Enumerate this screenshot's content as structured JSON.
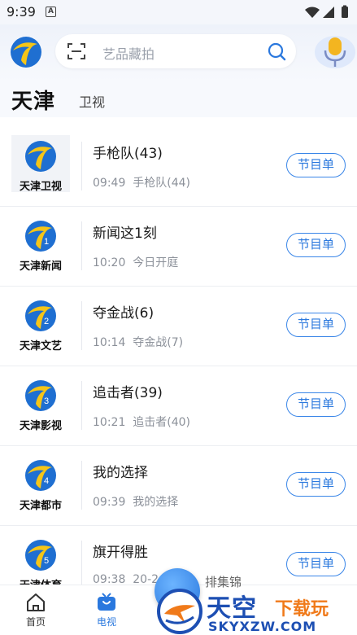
{
  "status_bar": {
    "time": "9:39",
    "notification_letter": "A"
  },
  "search": {
    "placeholder": "艺品藏拍"
  },
  "title_row": {
    "title": "天津",
    "tab": "卫视"
  },
  "channels": [
    {
      "name": "天津卫视",
      "badge": "",
      "now": "手枪队(43)",
      "next_time": "09:49",
      "next_title": "手枪队(44)",
      "button": "节目单"
    },
    {
      "name": "天津新闻",
      "badge": "1",
      "now": "新闻这1刻",
      "next_time": "10:20",
      "next_title": "今日开庭",
      "button": "节目单"
    },
    {
      "name": "天津文艺",
      "badge": "2",
      "now": "夺金战(6)",
      "next_time": "10:14",
      "next_title": "夺金战(7)",
      "button": "节目单"
    },
    {
      "name": "天津影视",
      "badge": "3",
      "now": "追击者(39)",
      "next_time": "10:21",
      "next_title": "追击者(40)",
      "button": "节目单"
    },
    {
      "name": "天津都市",
      "badge": "4",
      "now": "我的选择",
      "next_time": "09:39",
      "next_title": "我的选择",
      "button": "节目单"
    },
    {
      "name": "天津体育",
      "badge": "5",
      "now": "旗开得胜",
      "next_time": "09:38",
      "next_title": "20-2",
      "button": "节目单"
    }
  ],
  "float": {
    "label": "排集锦"
  },
  "bottom_nav": [
    {
      "label": "首页",
      "icon": "home-icon",
      "active": false
    },
    {
      "label": "电视",
      "icon": "tv-icon",
      "active": true
    }
  ],
  "watermark": {
    "brand": "天空",
    "tagline": "下载玩",
    "url": "SKYXZW.COM"
  },
  "colors": {
    "accent": "#2a78de",
    "logo_yellow": "#f5c518",
    "logo_blue": "#1f6fd1"
  }
}
